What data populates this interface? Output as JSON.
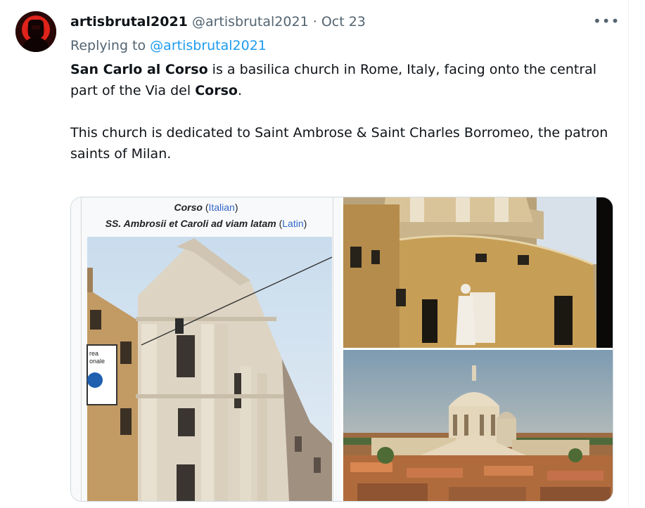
{
  "tweet": {
    "display_name": "artisbrutal2021",
    "handle": "@artisbrutal2021",
    "separator": "·",
    "date": "Oct 23",
    "more_label": "•••",
    "replying_prefix": "Replying to",
    "replying_to": "@artisbrutal2021",
    "paragraph1": {
      "bold1": "San Carlo al Corso",
      "text1": " is a basilica church in Rome, Italy, facing onto the central part of the Via del ",
      "bold2": "Corso",
      "text2": "."
    },
    "paragraph2": "This church is dedicated to Saint Ambrose & Saint Charles Borromeo, the patron saints of Milan."
  },
  "media": {
    "caption1_name": "Corso",
    "caption1_lang": "Italian",
    "caption2_name": "SS. Ambrosii et Caroli ad viam latam",
    "caption2_lang": "Latin",
    "sign_text": "rea\nonale"
  },
  "colors": {
    "text_primary": "#0f1419",
    "text_secondary": "#536471",
    "link": "#1d9bf0",
    "border": "#cfd9de"
  }
}
